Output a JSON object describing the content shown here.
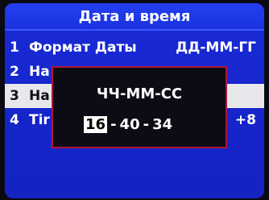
{
  "header": {
    "title": "Дата и время"
  },
  "menu": {
    "items": [
      {
        "num": "1",
        "label": "Формат Даты",
        "value": "ДД-ММ-ГГ"
      },
      {
        "num": "2",
        "label": "На",
        "value": ""
      },
      {
        "num": "3",
        "label": "На",
        "value": ""
      },
      {
        "num": "4",
        "label": "Tir",
        "value": "+8"
      }
    ],
    "selected_index": 2
  },
  "dialog": {
    "format": "ЧЧ-ММ-СС",
    "hours": "16",
    "minutes": "40",
    "seconds": "34",
    "separator": "-"
  }
}
